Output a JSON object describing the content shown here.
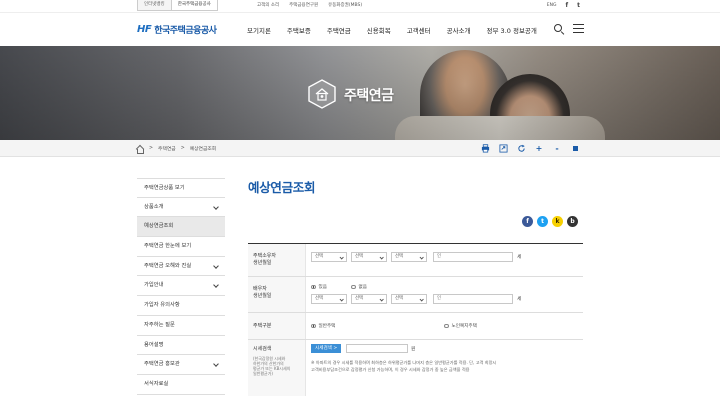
{
  "util": {
    "tabs": [
      "인터넷뱅킹",
      "한국주택금융공사"
    ],
    "links": [
      "고객의 소리",
      "주택금융연구원",
      "유동화증권(MBS)"
    ],
    "lang": "ENG",
    "sns": [
      "f",
      "t"
    ]
  },
  "header": {
    "logo_mark": "HF",
    "logo_text": "한국주택금융공사",
    "nav": [
      "모기지론",
      "주택보증",
      "주택연금",
      "신용회복",
      "고객센터",
      "공사소개",
      "정부 3.0 정보공개"
    ]
  },
  "hero": {
    "title": "주택연금"
  },
  "breadcrumb": {
    "items": [
      "주택연금",
      "예상연금조회"
    ],
    "tools": [
      "print-icon",
      "share-icon",
      "refresh-icon",
      "+",
      "-",
      "square"
    ]
  },
  "sidebar": {
    "items": [
      {
        "label": "주택연금상품 보기",
        "chevron": false,
        "active": false
      },
      {
        "label": "상품소개",
        "chevron": true,
        "active": false
      },
      {
        "label": "예상연금조회",
        "chevron": false,
        "active": true
      },
      {
        "label": "주택연금 한눈에 보기",
        "chevron": false,
        "active": false
      },
      {
        "label": "주택연금 오해와 진실",
        "chevron": true,
        "active": false
      },
      {
        "label": "가입안내",
        "chevron": true,
        "active": false
      },
      {
        "label": "가입자 유의사항",
        "chevron": false,
        "active": false
      },
      {
        "label": "자주하는 질문",
        "chevron": false,
        "active": false
      },
      {
        "label": "용어설명",
        "chevron": false,
        "active": false
      },
      {
        "label": "주택연금 홍보관",
        "chevron": true,
        "active": false
      },
      {
        "label": "서식자료실",
        "chevron": false,
        "active": false
      }
    ]
  },
  "main": {
    "title": "예상연금조회",
    "share": [
      {
        "name": "facebook",
        "glyph": "f",
        "color": "#3b5998"
      },
      {
        "name": "twitter",
        "glyph": "t",
        "color": "#1da1f2"
      },
      {
        "name": "kakao",
        "glyph": "k",
        "color": "#f7d000"
      },
      {
        "name": "band",
        "glyph": "b",
        "color": "#333333"
      }
    ],
    "form": {
      "owner": {
        "label1": "주택소유자",
        "label2": "생년월일",
        "selects": [
          "선택",
          "선택",
          "선택"
        ],
        "age_unit": "인",
        "age_suffix": "세"
      },
      "spouse": {
        "label1": "배우자",
        "label2": "생년월일",
        "radio_yes": "있음",
        "radio_no": "없음",
        "selects": [
          "선택",
          "선택",
          "선택"
        ],
        "age_unit": "인",
        "age_suffix": "세"
      },
      "house_type": {
        "label": "주택구분",
        "option1": "일반주택",
        "option2": "노인복지주택"
      },
      "price": {
        "label": "시세검색",
        "sub1": "(한국감정원 시세와",
        "sub2": "하한가의 산한가의",
        "sub3": "평균가 또는 KB시세의",
        "sub4": "일반평균가)",
        "button": "시세검색 >",
        "unit": "원",
        "note1": "※ 아파트의 경우 시세를 적용하며 최하층은 하위평균가를 나머지 층은 일반평균가를 적용. 단, 고객 희망시",
        "note2": "고객비용부담조건으로 감정평가 신청 가능하며, 이 경우 시세와 감정가 중 높은 금액을 적용"
      }
    }
  }
}
